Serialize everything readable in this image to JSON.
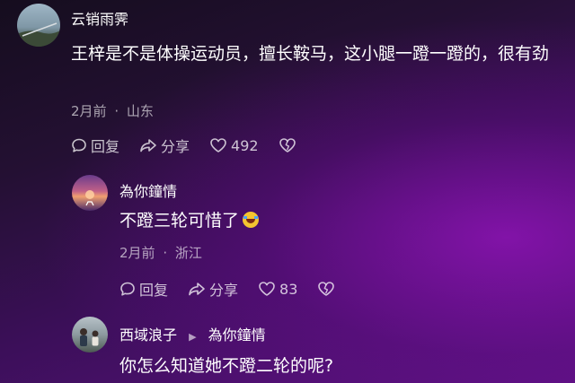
{
  "comments": [
    {
      "username": "云销雨霁",
      "text": "王梓是不是体操运动员，擅长鞍马，这小腿一蹬一蹬的，很有劲",
      "time": "2月前",
      "location": "山东",
      "reply_label": "回复",
      "share_label": "分享",
      "likes": "492"
    },
    {
      "username": "為你鐘情",
      "text": "不蹬三轮可惜了",
      "emoji": "grinning-tears-emoji",
      "time": "2月前",
      "location": "浙江",
      "reply_label": "回复",
      "share_label": "分享",
      "likes": "83"
    },
    {
      "username": "西域浪子",
      "reply_to": "為你鐘情",
      "text": "你怎么知道她不蹬二轮的呢?"
    }
  ],
  "meta_separator": "·",
  "reply_arrow": "▶",
  "colors": {
    "background_dark": "#150d1e",
    "background_purple": "#5b1280",
    "text_primary": "#ffffff",
    "text_secondary": "#b8aec2"
  },
  "icons": [
    "reply-icon",
    "share-icon",
    "heart-icon",
    "dislike-icon"
  ]
}
